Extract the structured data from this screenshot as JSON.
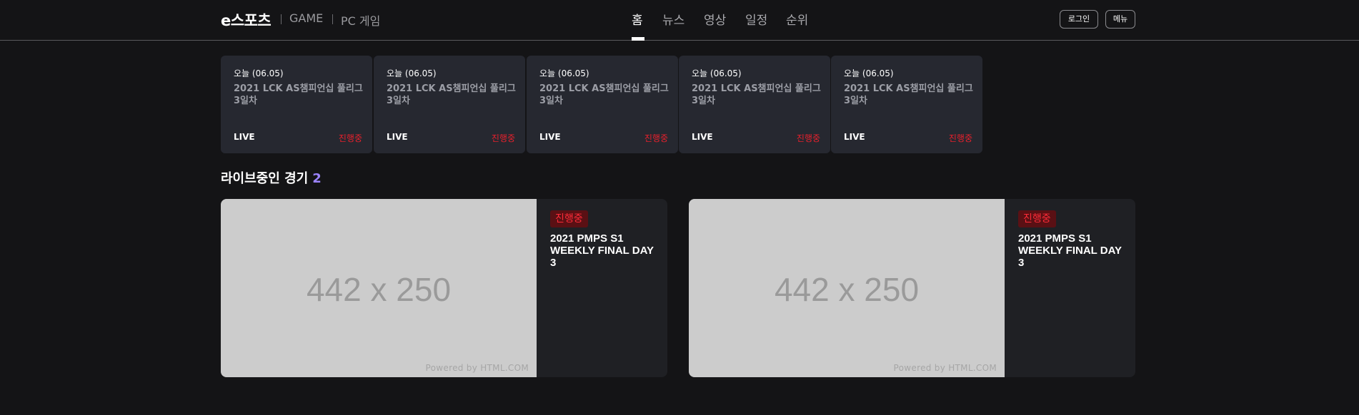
{
  "header": {
    "logo": "e스포츠",
    "breadcrumbs": [
      "GAME",
      "PC 게임"
    ],
    "nav": [
      "홈",
      "뉴스",
      "영상",
      "일정",
      "순위"
    ],
    "active_nav": "홈",
    "login_label": "로그인",
    "menu_label": "메뉴"
  },
  "schedule": [
    {
      "date": "오늘 (06.05)",
      "title": "2021 LCK AS챔피언십 풀리그 3일차",
      "live": "LIVE",
      "status": "진행중"
    },
    {
      "date": "오늘 (06.05)",
      "title": "2021 LCK AS챔피언십 풀리그 3일차",
      "live": "LIVE",
      "status": "진행중"
    },
    {
      "date": "오늘 (06.05)",
      "title": "2021 LCK AS챔피언십 풀리그 3일차",
      "live": "LIVE",
      "status": "진행중"
    },
    {
      "date": "오늘 (06.05)",
      "title": "2021 LCK AS챔피언십 풀리그 3일차",
      "live": "LIVE",
      "status": "진행중"
    },
    {
      "date": "오늘 (06.05)",
      "title": "2021 LCK AS챔피언십 풀리그 3일차",
      "live": "LIVE",
      "status": "진행중"
    }
  ],
  "live_section": {
    "title": "라이브중인 경기",
    "count": "2",
    "matches": [
      {
        "thumb_text": "442 x 250",
        "thumb_credit": "Powered by HTML.COM",
        "badge": "진행중",
        "title": "2021 PMPS S1 WEEKLY FINAL DAY 3"
      },
      {
        "thumb_text": "442 x 250",
        "thumb_credit": "Powered by HTML.COM",
        "badge": "진행중",
        "title": "2021 PMPS S1 WEEKLY FINAL DAY 3"
      }
    ]
  },
  "colors": {
    "background": "#141416",
    "card": "#262830",
    "live_red": "#e8202c",
    "count_accent": "#9c84ff"
  }
}
